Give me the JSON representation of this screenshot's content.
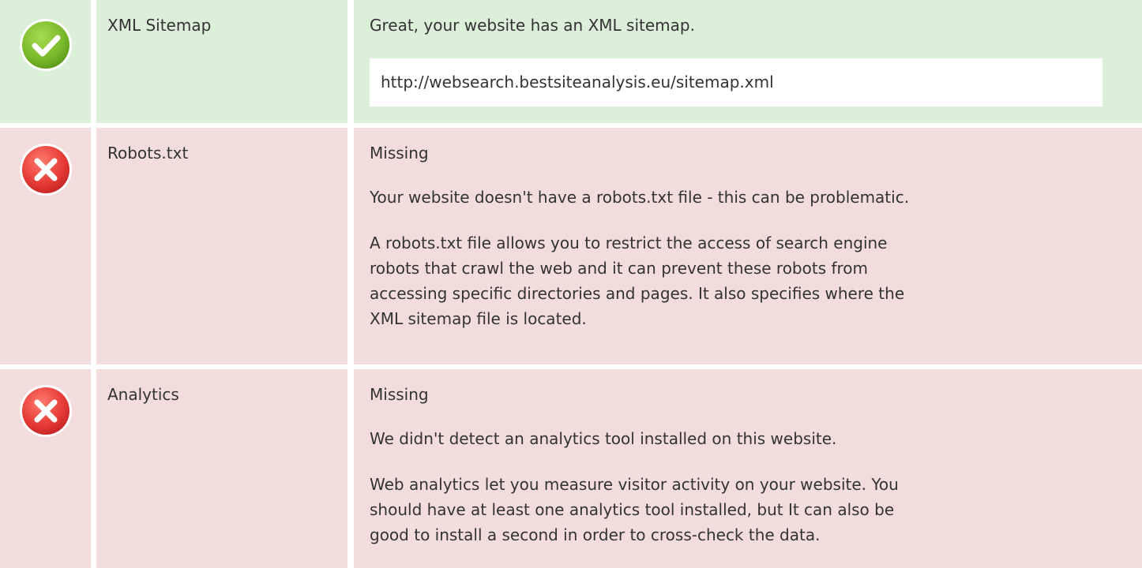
{
  "checks": [
    {
      "status": "pass",
      "icon": "check-circle-icon",
      "name": "XML Sitemap",
      "headline": "Great, your website has an XML sitemap.",
      "url": "http://websearch.bestsiteanalysis.eu/sitemap.xml"
    },
    {
      "status": "fail",
      "icon": "error-circle-icon",
      "name": "Robots.txt",
      "headline": "Missing",
      "detail": "Your website doesn't have a robots.txt file - this can be problematic.",
      "description_lines": [
        "A robots.txt file allows you to restrict the access of search engine",
        "robots that crawl the web and it can prevent these robots from",
        "accessing specific directories and pages. It also specifies where the",
        "XML sitemap file is located."
      ]
    },
    {
      "status": "fail",
      "icon": "error-circle-icon",
      "name": "Analytics",
      "headline": "Missing",
      "detail": "We didn't detect an analytics tool installed on this website.",
      "description_lines": [
        "Web analytics let you measure visitor activity on your website. You",
        "should have at least one analytics tool installed, but It can also be",
        "good to install a second in order to cross-check the data."
      ]
    }
  ],
  "colors": {
    "pass_background": "#dcefd9",
    "fail_background": "#f2dcdc",
    "pass_icon": "#76b72a",
    "fail_icon": "#e53935",
    "text": "#333333"
  }
}
